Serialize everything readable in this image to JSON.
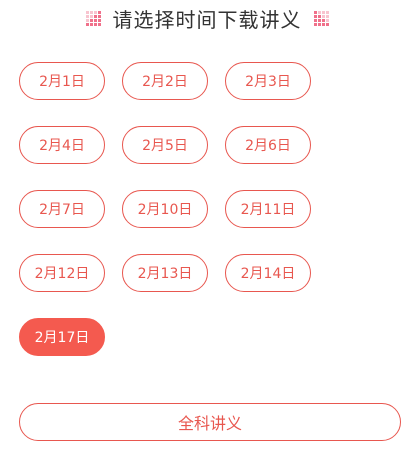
{
  "header": {
    "title": "请选择时间下载讲义",
    "decor_icon": "dot-grid-icon"
  },
  "dates": [
    {
      "label": "2月1日",
      "selected": false
    },
    {
      "label": "2月2日",
      "selected": false
    },
    {
      "label": "2月3日",
      "selected": false
    },
    {
      "label": "2月4日",
      "selected": false
    },
    {
      "label": "2月5日",
      "selected": false
    },
    {
      "label": "2月6日",
      "selected": false
    },
    {
      "label": "2月7日",
      "selected": false
    },
    {
      "label": "2月10日",
      "selected": false
    },
    {
      "label": "2月11日",
      "selected": false
    },
    {
      "label": "2月12日",
      "selected": false
    },
    {
      "label": "2月13日",
      "selected": false
    },
    {
      "label": "2月14日",
      "selected": false
    },
    {
      "label": "2月17日",
      "selected": true
    }
  ],
  "all_subjects_label": "全科讲义",
  "colors": {
    "accent": "#e8574f",
    "accent_filled": "#f45a4f",
    "title_text": "#333333",
    "decor_dot_dark": "#f0708a",
    "decor_dot_light": "#f8c4cf"
  }
}
